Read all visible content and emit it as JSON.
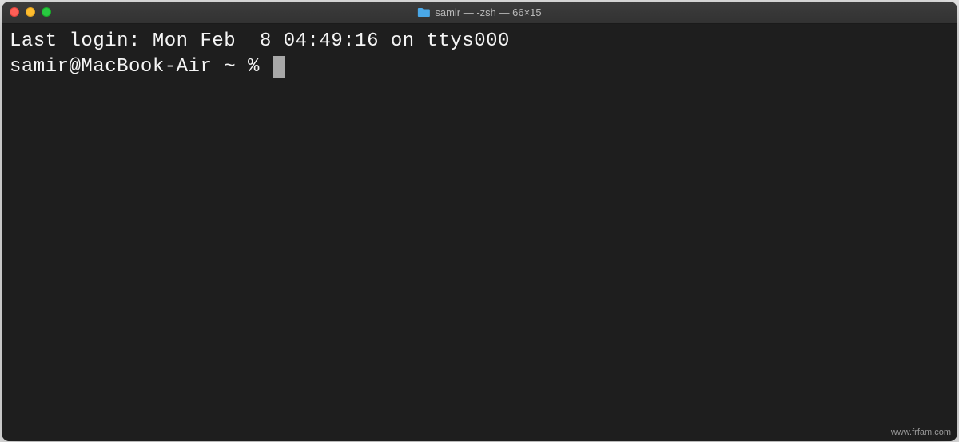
{
  "window": {
    "title": "samir — -zsh — 66×15"
  },
  "terminal": {
    "last_login_line": "Last login: Mon Feb  8 04:49:16 on ttys000",
    "prompt": "samir@MacBook-Air ~ % "
  },
  "watermark": "www.frfam.com"
}
